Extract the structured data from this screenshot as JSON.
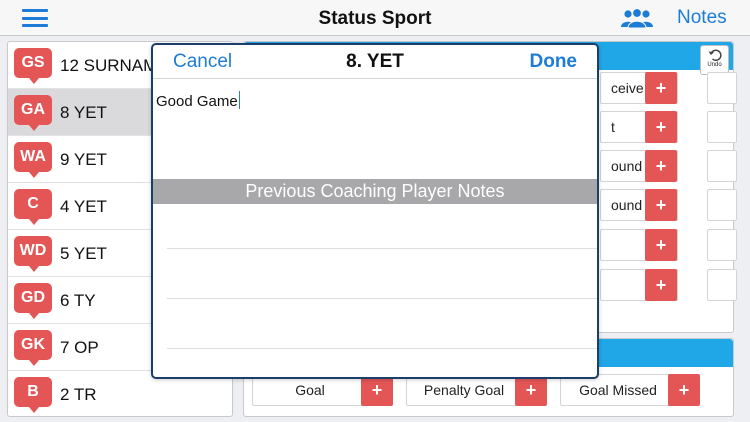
{
  "header": {
    "title": "Status Sport",
    "notes_label": "Notes",
    "menu_icon": "hamburger-menu-icon",
    "team_icon": "people-group-icon"
  },
  "players": [
    {
      "position": "GS",
      "name": "12 SURNAM",
      "selected": false
    },
    {
      "position": "GA",
      "name": "8 YET",
      "selected": true
    },
    {
      "position": "WA",
      "name": "9 YET",
      "selected": false
    },
    {
      "position": "C",
      "name": "4 YET",
      "selected": false
    },
    {
      "position": "WD",
      "name": "5 YET",
      "selected": false
    },
    {
      "position": "GD",
      "name": "6 TY",
      "selected": false
    },
    {
      "position": "GK",
      "name": "7 OP",
      "selected": false
    },
    {
      "position": "B",
      "name": "2 TR",
      "selected": false
    }
  ],
  "stats": {
    "undo_label": "Undo",
    "plus_symbol": "+",
    "buttons": [
      "ceive",
      "t",
      "ound",
      "ound",
      "",
      ""
    ]
  },
  "goals": {
    "plus_symbol": "+",
    "buttons": [
      "Goal",
      "Penalty Goal",
      "Goal Missed"
    ]
  },
  "modal": {
    "cancel_label": "Cancel",
    "title": "8. YET",
    "done_label": "Done",
    "note_text": "Good Game",
    "previous_notes_title": "Previous Coaching Player Notes"
  },
  "colors": {
    "accent_blue": "#1d7cd6",
    "badge_red": "#e45656",
    "header_blue": "#20a7e8",
    "modal_border": "#1b3f6a"
  }
}
